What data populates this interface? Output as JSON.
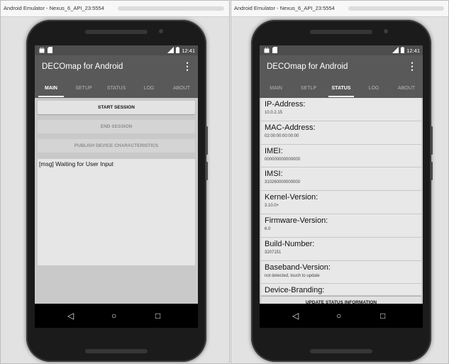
{
  "left_window": {
    "title": "Android Emulator - Nexus_6_API_23:5554",
    "status_time": "12:41",
    "app_title": "DECOmap for Android",
    "menu_glyph": "⋮",
    "tabs": [
      {
        "label": "MAIN",
        "active": true
      },
      {
        "label": "SETUP",
        "active": false
      },
      {
        "label": "STATUS",
        "active": false
      },
      {
        "label": "LOG",
        "active": false
      },
      {
        "label": "ABOUT",
        "active": false
      }
    ],
    "buttons": {
      "start_session": "START SESSION",
      "end_session": "END SESSION",
      "publish": "PUBLISH DEVICE CHARACTERISTICS"
    },
    "log_text": "[msg] Waiting for User Input"
  },
  "right_window": {
    "title": "Android Emulator - Nexus_6_API_23:5554",
    "status_time": "12:41",
    "app_title": "DECOmap for Android",
    "menu_glyph": "⋮",
    "tabs": [
      {
        "label": "MAIN",
        "active": false
      },
      {
        "label": "SETLP",
        "active": false
      },
      {
        "label": "STATUS",
        "active": true
      },
      {
        "label": "LOG",
        "active": false
      },
      {
        "label": "ABOUT",
        "active": false
      }
    ],
    "status_items": [
      {
        "label": "IP-Address:",
        "value": "10.0.2.15"
      },
      {
        "label": "MAC-Address:",
        "value": "02:00:00:00:00:00"
      },
      {
        "label": "IMEI:",
        "value": "000000000000000"
      },
      {
        "label": "IMSI:",
        "value": "310260000000000"
      },
      {
        "label": "Kernel-Version:",
        "value": "3.10.0+"
      },
      {
        "label": "Firmware-Version:",
        "value": "6.0"
      },
      {
        "label": "Build-Number:",
        "value": "3207151"
      },
      {
        "label": "Baseband-Version:",
        "value": "not detected, touch to update"
      },
      {
        "label": "Device-Branding:",
        "value": ""
      }
    ],
    "update_button": "UPDATE STATUS INFORMATION"
  },
  "nav": {
    "back": "◁",
    "home": "○",
    "recents": "□"
  },
  "icons": {
    "notif": "android-debug-icon",
    "sdcard": "sd-card-icon",
    "signal": "signal-icon",
    "battery": "battery-icon"
  },
  "colors": {
    "appbar": "#595959",
    "statusbar": "#4d4d4d",
    "screen_bg": "#c9c9c9"
  }
}
